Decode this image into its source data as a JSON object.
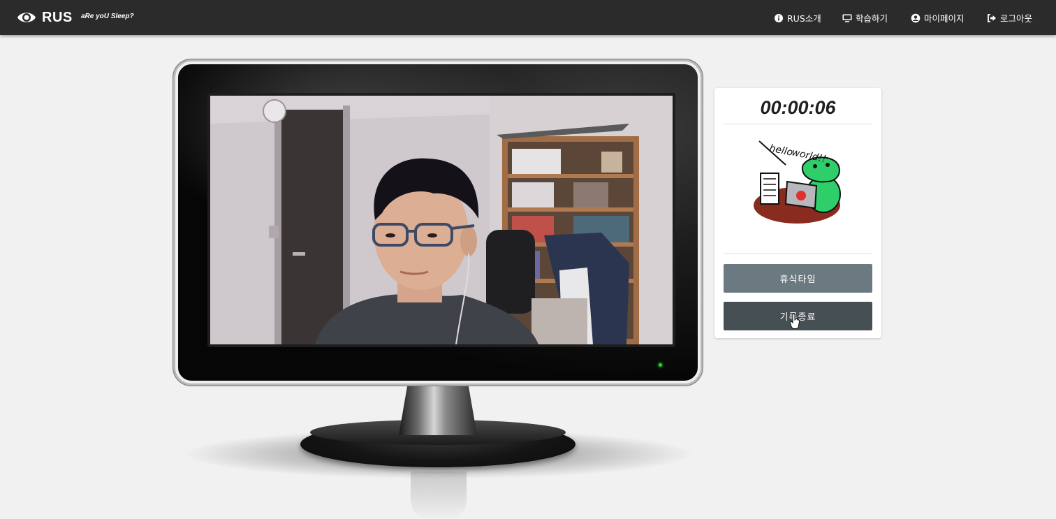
{
  "brand": {
    "name": "RUS",
    "tagline": "aRe yoU Sleep?",
    "icon": "eye-icon"
  },
  "nav": {
    "about": {
      "label": "RUS소개",
      "icon": "info-icon"
    },
    "study": {
      "label": "학습하기",
      "icon": "monitor-icon"
    },
    "mypage": {
      "label": "마이페이지",
      "icon": "user-circle-icon"
    },
    "logout": {
      "label": "로그아웃",
      "icon": "sign-out-icon"
    }
  },
  "panel": {
    "timer": "00:00:06",
    "mascot_icon": "dinosaur-mascot-icon",
    "break_button": "휴식타임",
    "end_button": "기록종료"
  },
  "colors": {
    "navbar": "#2b2b2b",
    "page_background": "#f1f1f1",
    "break_button": "#6a7a80",
    "end_button": "#465054",
    "power_led": "#22dd22"
  }
}
